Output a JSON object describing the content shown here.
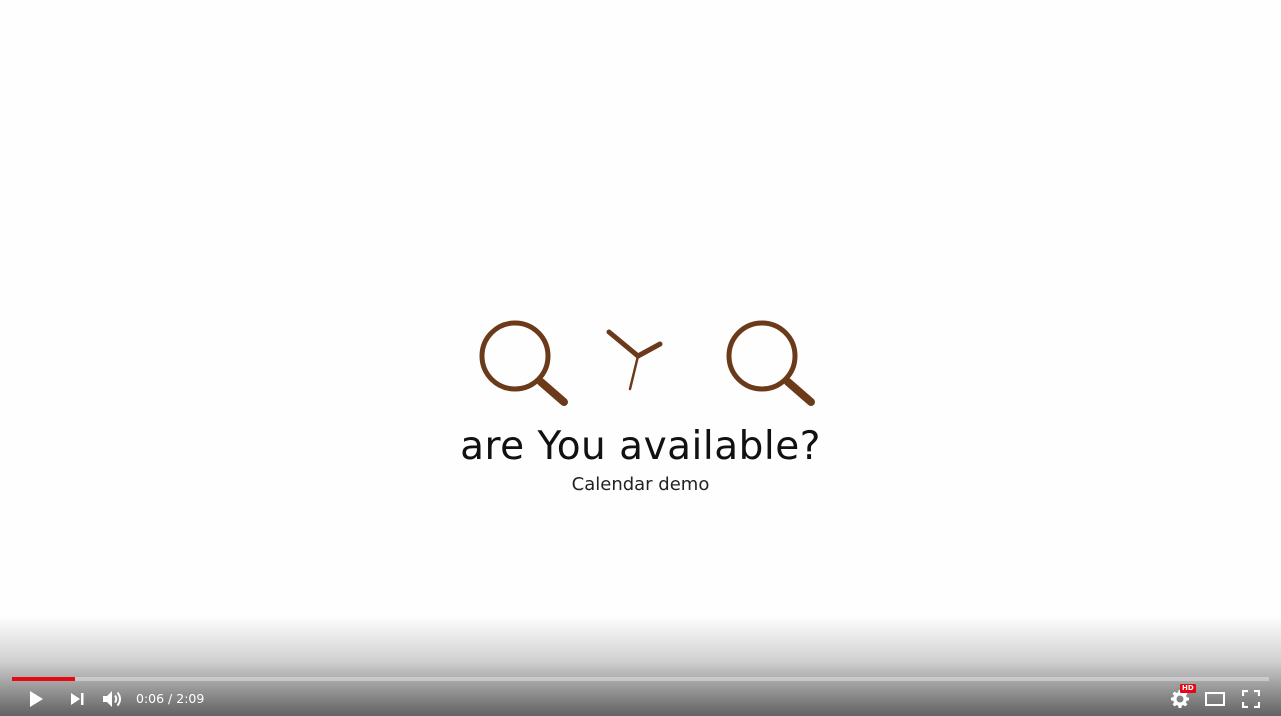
{
  "video": {
    "headline": "are You available?",
    "subtitle": "Calendar demo",
    "logo_icons": [
      "search-icon",
      "clock-hands-icon",
      "search-icon"
    ],
    "logo_color": "#6b3a1a"
  },
  "controls": {
    "current_time": "0:06",
    "separator": " / ",
    "duration": "2:09",
    "progress_fraction": 0.05,
    "progress_color": "#e50914",
    "settings_badge": "HD",
    "icons": {
      "play": "play-icon",
      "next": "next-icon",
      "volume": "volume-icon",
      "settings": "gear-icon",
      "theater": "theater-mode-icon",
      "fullscreen": "fullscreen-icon"
    }
  }
}
